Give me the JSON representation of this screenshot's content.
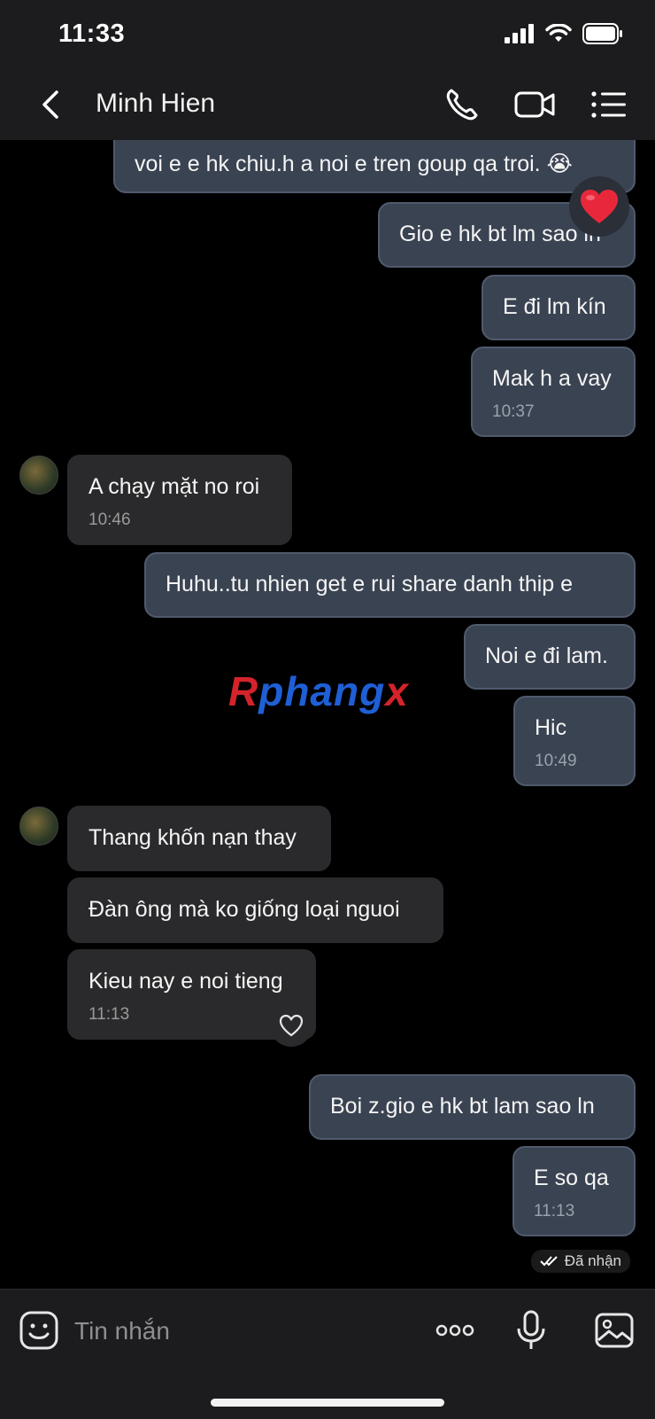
{
  "status_bar": {
    "time": "11:33"
  },
  "header": {
    "contact_name": "Minh Hien"
  },
  "messages": [
    {
      "text": "voi e e hk chiu.h a noi e tren goup qa troi. 😭"
    },
    {
      "text": "Gio e hk bt lm sao ln"
    },
    {
      "text": "E đi lm kín"
    },
    {
      "text": "Mak h a vay",
      "time": "10:37"
    },
    {
      "text": "A chạy mặt no roi",
      "time": "10:46"
    },
    {
      "text": "Huhu..tu nhien get e rui share danh thip e"
    },
    {
      "text": "Noi e đi lam."
    },
    {
      "text": "Hic",
      "time": "10:49"
    },
    {
      "text": "Thang khốn nạn thay"
    },
    {
      "text": "Đàn ông mà ko giống loại nguoi"
    },
    {
      "text": "Kieu nay e noi tieng",
      "time": "11:13"
    },
    {
      "text": "Boi z.gio e hk bt lam sao ln"
    },
    {
      "text": "E so qa",
      "time": "11:13"
    }
  ],
  "watermark": {
    "part1": "R",
    "part2": "phang",
    "part3": "x"
  },
  "seen_status": "Đã nhận",
  "composer": {
    "placeholder": "Tin nhắn"
  },
  "colors": {
    "outgoing_bubble": "#3a4352",
    "incoming_bubble": "#2a2a2c",
    "background": "#000000",
    "reaction": "#e8283a"
  },
  "icons": [
    "back-icon",
    "phone-icon",
    "video-call-icon",
    "menu-icon",
    "heart-reaction-icon",
    "like-heart-icon",
    "double-check-icon",
    "sticker-icon",
    "more-icon",
    "microphone-icon",
    "image-icon"
  ]
}
